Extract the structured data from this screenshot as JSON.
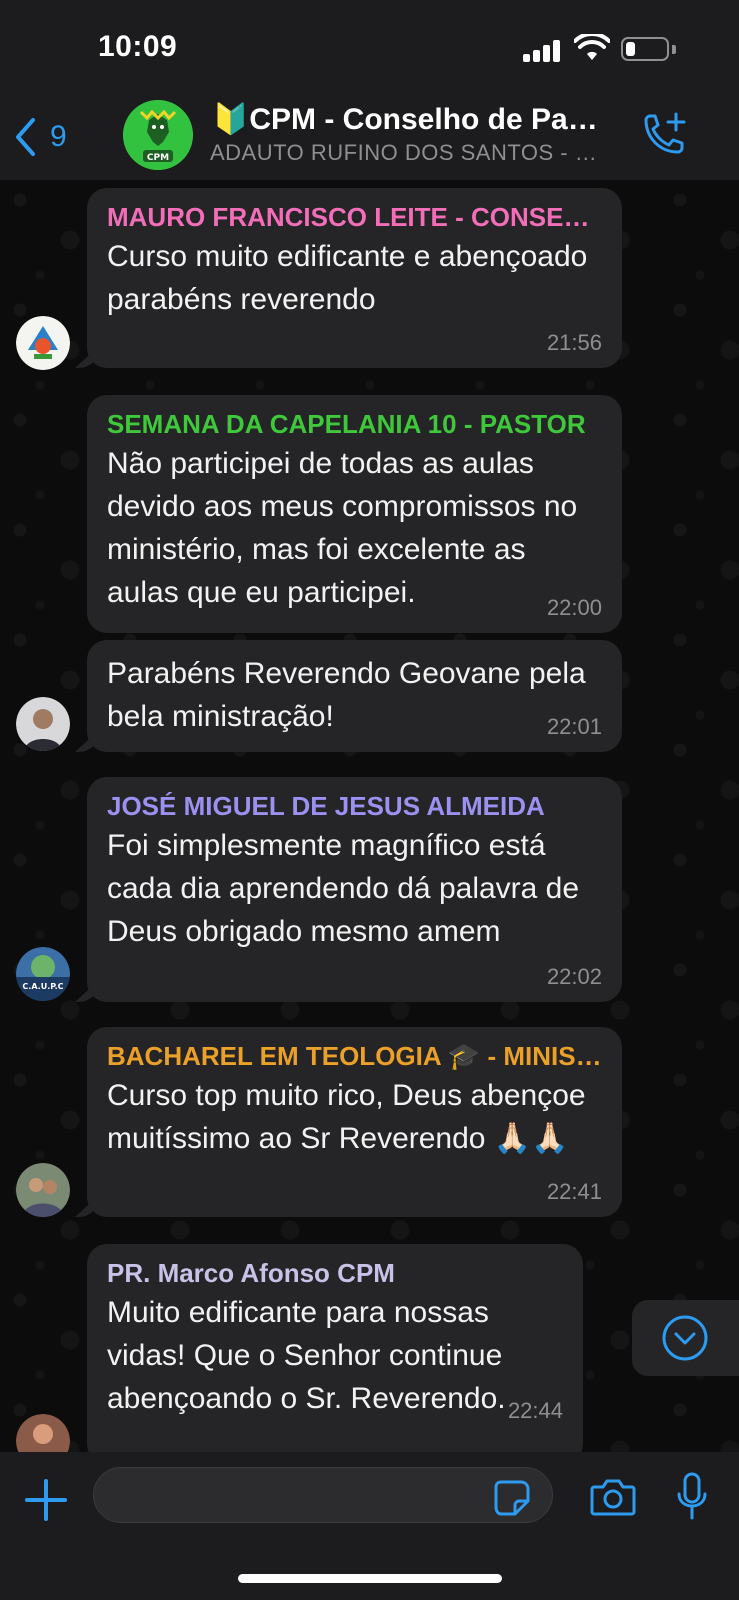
{
  "status_bar": {
    "time": "10:09"
  },
  "header": {
    "back_count": "9",
    "title": "🔰CPM - Conselho de Pastores e Ministros",
    "subtitle": "ADAUTO RUFINO DOS SANTOS - …",
    "avatar_text": "CPM"
  },
  "messages": [
    {
      "sender": "MAURO FRANCISCO LEITE - CONSELHEIRO",
      "sender_color": "#f26eb8",
      "text": "Curso muito edificante e abençoado parabéns reverendo",
      "time": "21:56"
    },
    {
      "sender": "SEMANA DA CAPELANIA 10 - PASTOR",
      "sender_color": "#3ec83a",
      "text": "Não participei de todas as aulas devido aos meus compromissos no ministério, mas foi excelente as aulas que eu participei.",
      "time": "22:00"
    },
    {
      "sender": "",
      "text": "Parabéns Reverendo Geovane pela bela ministração!",
      "time": "22:01"
    },
    {
      "sender": "JOSÉ MIGUEL DE JESUS ALMEIDA",
      "sender_color": "#9b91f0",
      "text": "Foi simplesmente magnífico está cada dia aprendendo dá palavra de Deus obrigado mesmo amem",
      "time": "22:02",
      "avatar_text": "C.A.U.P.C"
    },
    {
      "sender": "BACHAREL EM TEOLOGIA 🎓 - MINISTRO",
      "sender_color": "#eba02a",
      "text": "Curso top muito rico, Deus abençoe muitíssimo ao Sr Reverendo 🙏🏻🙏🏻",
      "time": "22:41"
    },
    {
      "sender": "PR. Marco Afonso CPM",
      "sender_color": "#c9c2e8",
      "text": "Muito edificante para nossas vidas! Que o Senhor continue abençoando o Sr. Reverendo.",
      "time": "22:44"
    }
  ],
  "composer": {
    "input_value": "",
    "input_placeholder": ""
  },
  "colors": {
    "accent": "#2c9bf0",
    "bubble": "#252527",
    "background": "#0b0b0b"
  },
  "icons": [
    "back-chevron-icon",
    "call-add-icon",
    "scroll-down-icon",
    "plus-icon",
    "sticker-icon",
    "camera-icon",
    "microphone-icon"
  ]
}
